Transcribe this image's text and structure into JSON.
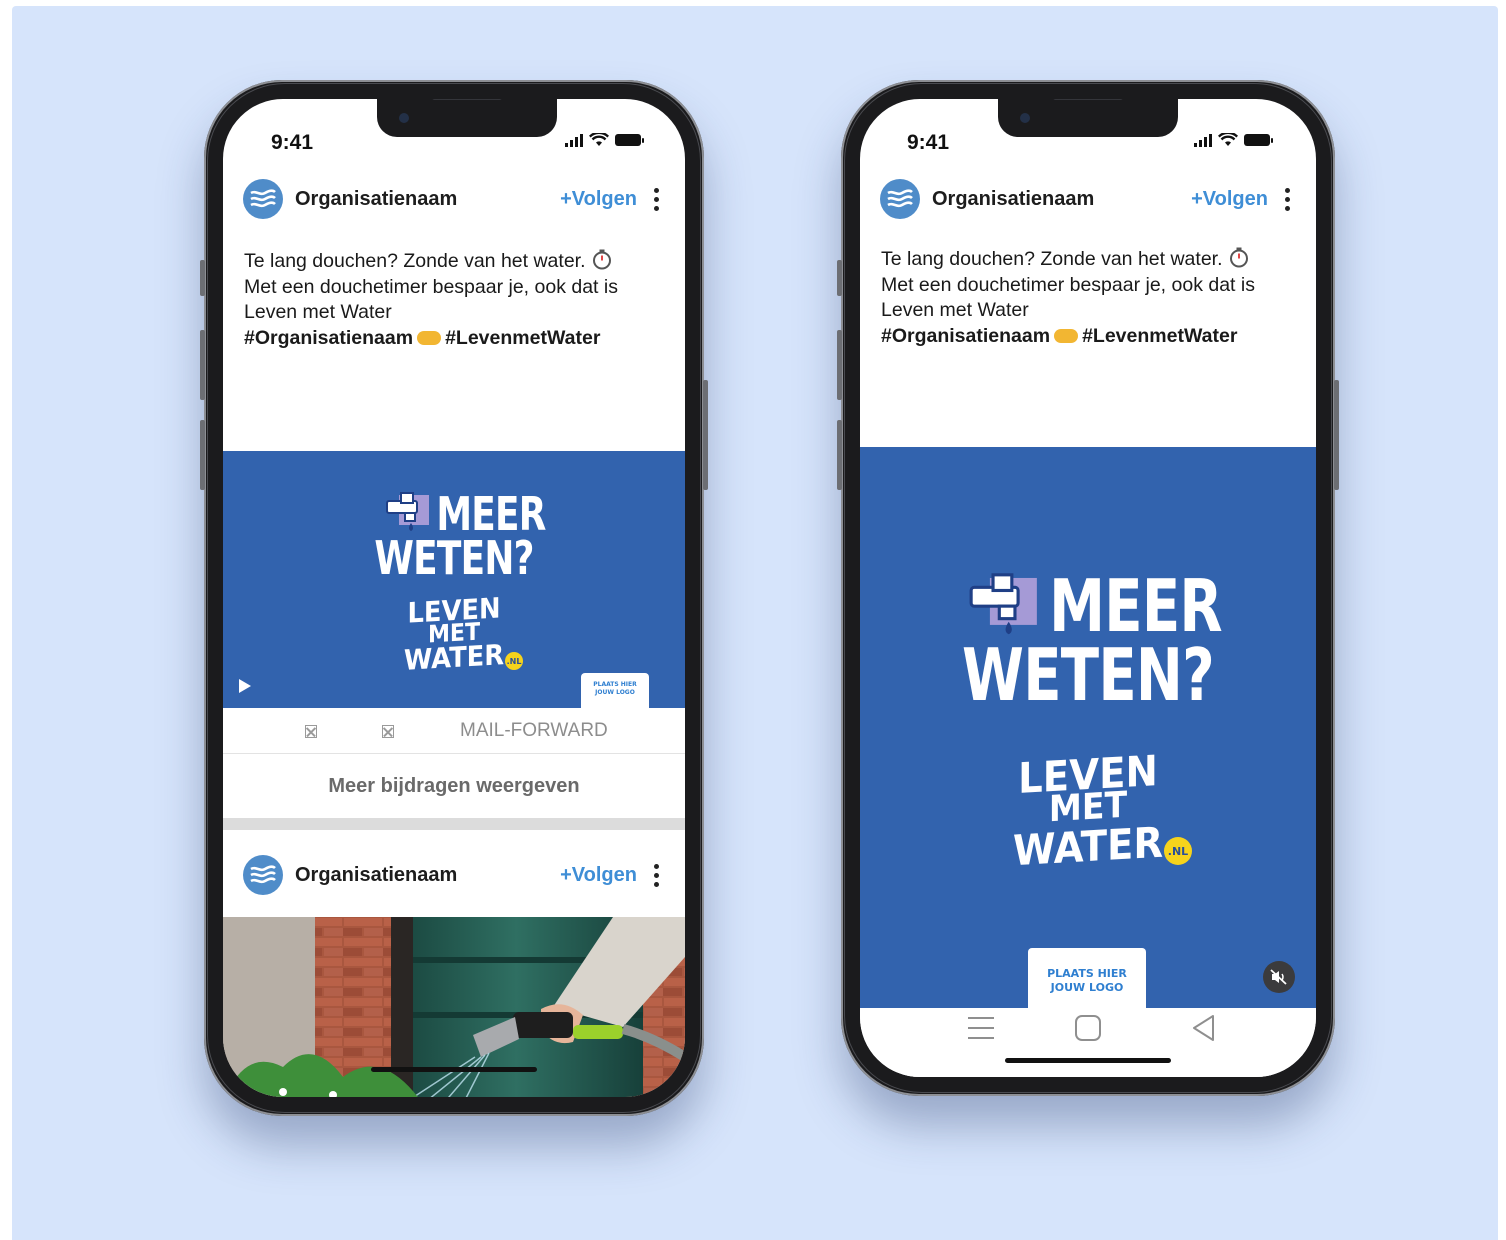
{
  "colors": {
    "background": "#d6e4fb",
    "brand_blue": "#3263ae",
    "follow_blue": "#3f8ed6",
    "badge_yellow": "#f6d31c"
  },
  "status": {
    "time": "9:41"
  },
  "post": {
    "org_name": "Organisatienaam",
    "follow_label": "+Volgen",
    "text_line1": "Te lang douchen? Zonde van het water.",
    "text_line2": "Met een douchetimer bespaar je, ook dat is",
    "text_line3": "Leven met Water",
    "tag1": "#Organisatienaam",
    "tag2": "#LevenmetWater"
  },
  "banner": {
    "meer": "MEER",
    "weten": "WETEN?",
    "leven": "LEVEN",
    "met": "MET",
    "water": "WATER",
    "nl": ".NL",
    "logo_line1": "PLAATS HIER",
    "logo_line2": "JOUW LOGO"
  },
  "actions": {
    "placeholder": "⊠",
    "share_label": "MAIL-FORWARD"
  },
  "more_posts_label": "Meer bijdragen weergeven",
  "icons": [
    "organisation-logo-icon",
    "timer-icon",
    "handshake-icon",
    "play-icon",
    "mute-icon",
    "menu-icon",
    "home-icon",
    "back-icon",
    "signal-icon",
    "wifi-icon",
    "battery-icon",
    "kebab-icon"
  ]
}
